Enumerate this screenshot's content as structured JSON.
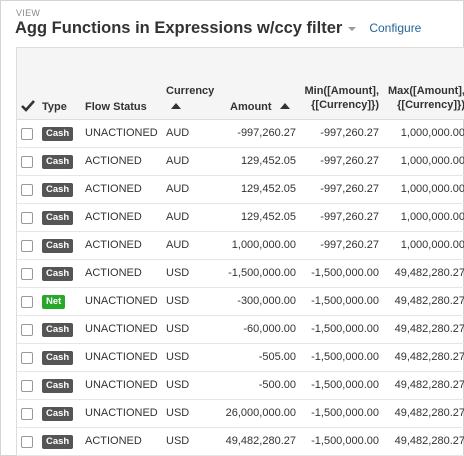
{
  "view_label": "VIEW",
  "title": "Agg Functions in Expressions w/ccy filter",
  "configure_label": "Configure",
  "columns": {
    "select_all_icon": "checkmark",
    "type": "Type",
    "flow_status": "Flow Status",
    "currency": "Currency",
    "amount": "Amount",
    "min_line1": "Min([Amount],",
    "min_line2": "{[Currency]})",
    "max_line1": "Max([Amount],",
    "max_line2": "{[Currency]})"
  },
  "colors": {
    "cash_badge": "#555555",
    "net_badge": "#28a828",
    "link": "#2a6496"
  },
  "rows": [
    {
      "type": "Cash",
      "status": "UNACTIONED",
      "ccy": "AUD",
      "amount": "-997,260.27",
      "min": "-997,260.27",
      "max": "1,000,000.00"
    },
    {
      "type": "Cash",
      "status": "ACTIONED",
      "ccy": "AUD",
      "amount": "129,452.05",
      "min": "-997,260.27",
      "max": "1,000,000.00"
    },
    {
      "type": "Cash",
      "status": "ACTIONED",
      "ccy": "AUD",
      "amount": "129,452.05",
      "min": "-997,260.27",
      "max": "1,000,000.00"
    },
    {
      "type": "Cash",
      "status": "ACTIONED",
      "ccy": "AUD",
      "amount": "129,452.05",
      "min": "-997,260.27",
      "max": "1,000,000.00"
    },
    {
      "type": "Cash",
      "status": "ACTIONED",
      "ccy": "AUD",
      "amount": "1,000,000.00",
      "min": "-997,260.27",
      "max": "1,000,000.00"
    },
    {
      "type": "Cash",
      "status": "ACTIONED",
      "ccy": "USD",
      "amount": "-1,500,000.00",
      "min": "-1,500,000.00",
      "max": "49,482,280.27"
    },
    {
      "type": "Net",
      "status": "UNACTIONED",
      "ccy": "USD",
      "amount": "-300,000.00",
      "min": "-1,500,000.00",
      "max": "49,482,280.27"
    },
    {
      "type": "Cash",
      "status": "UNACTIONED",
      "ccy": "USD",
      "amount": "-60,000.00",
      "min": "-1,500,000.00",
      "max": "49,482,280.27"
    },
    {
      "type": "Cash",
      "status": "UNACTIONED",
      "ccy": "USD",
      "amount": "-505.00",
      "min": "-1,500,000.00",
      "max": "49,482,280.27"
    },
    {
      "type": "Cash",
      "status": "UNACTIONED",
      "ccy": "USD",
      "amount": "-500.00",
      "min": "-1,500,000.00",
      "max": "49,482,280.27"
    },
    {
      "type": "Cash",
      "status": "UNACTIONED",
      "ccy": "USD",
      "amount": "26,000,000.00",
      "min": "-1,500,000.00",
      "max": "49,482,280.27"
    },
    {
      "type": "Cash",
      "status": "ACTIONED",
      "ccy": "USD",
      "amount": "49,482,280.27",
      "min": "-1,500,000.00",
      "max": "49,482,280.27"
    }
  ]
}
